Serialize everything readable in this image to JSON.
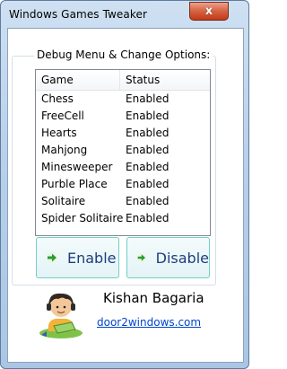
{
  "window": {
    "title": "Windows Games Tweaker",
    "close_glyph": "x"
  },
  "group": {
    "legend": "Debug Menu & Change Options:"
  },
  "list": {
    "columns": [
      "Game",
      "Status"
    ],
    "rows": [
      {
        "game": "Chess",
        "status": "Enabled"
      },
      {
        "game": "FreeCell",
        "status": "Enabled"
      },
      {
        "game": "Hearts",
        "status": "Enabled"
      },
      {
        "game": "Mahjong",
        "status": "Enabled"
      },
      {
        "game": "Minesweeper",
        "status": "Enabled"
      },
      {
        "game": "Purble Place",
        "status": "Enabled"
      },
      {
        "game": "Solitaire",
        "status": "Enabled"
      },
      {
        "game": "Spider Solitaire",
        "status": "Enabled"
      }
    ]
  },
  "buttons": {
    "enable": "Enable",
    "disable": "Disable",
    "arrow_icon": "green-arrow-icon"
  },
  "footer": {
    "author": "Kishan Bagaria",
    "website": "door2windows.com"
  },
  "colors": {
    "arrow": "#2e9b2e",
    "link": "#0044cc",
    "button_border": "#6fd0c7"
  }
}
